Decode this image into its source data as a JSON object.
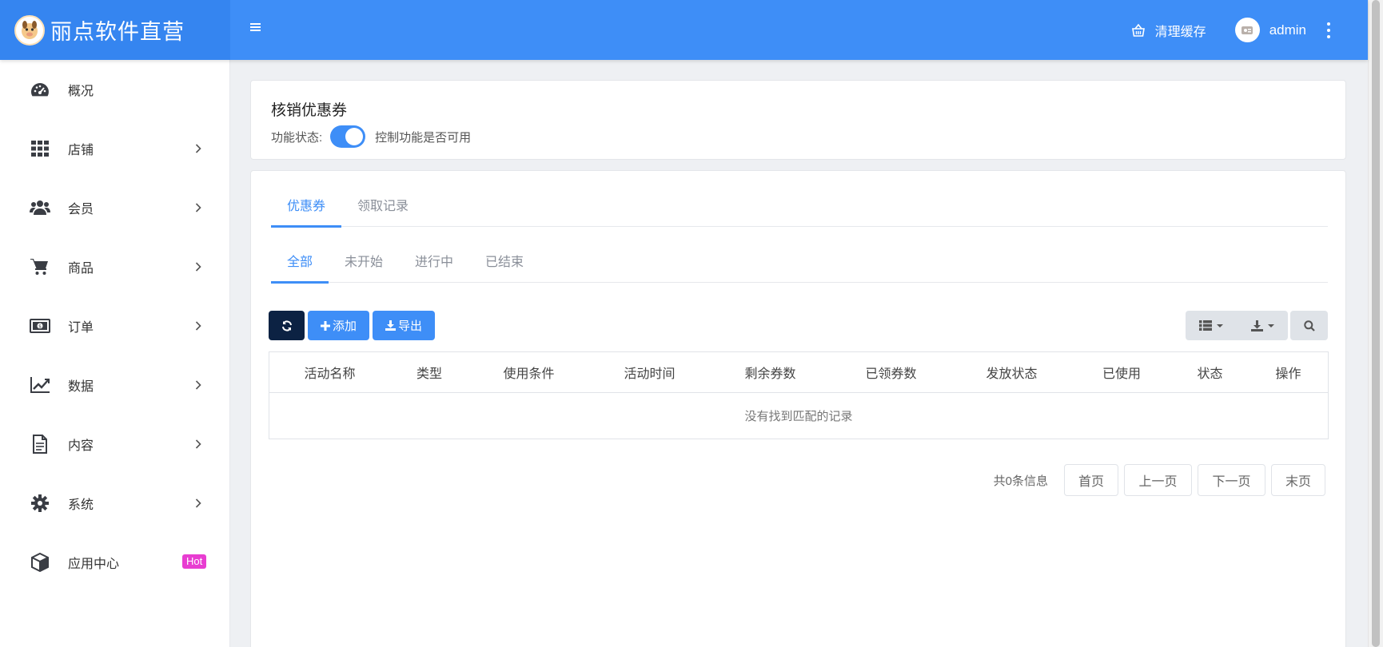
{
  "header": {
    "brand_title": "丽点软件直营",
    "clear_cache_label": "清理缓存",
    "user_name": "admin"
  },
  "sidebar": {
    "items": [
      {
        "label": "概况",
        "icon": "dashboard-icon",
        "has_submenu": false
      },
      {
        "label": "店铺",
        "icon": "grid-icon",
        "has_submenu": true
      },
      {
        "label": "会员",
        "icon": "users-icon",
        "has_submenu": true
      },
      {
        "label": "商品",
        "icon": "cart-icon",
        "has_submenu": true
      },
      {
        "label": "订单",
        "icon": "money-icon",
        "has_submenu": true
      },
      {
        "label": "数据",
        "icon": "line-chart-icon",
        "has_submenu": true
      },
      {
        "label": "内容",
        "icon": "document-icon",
        "has_submenu": true
      },
      {
        "label": "系统",
        "icon": "gear-icon",
        "has_submenu": true
      },
      {
        "label": "应用中心",
        "icon": "cube-icon",
        "has_submenu": false,
        "badge": "Hot"
      }
    ]
  },
  "status_card": {
    "title": "核销优惠券",
    "status_label": "功能状态:",
    "toggle_on": true,
    "status_hint": "控制功能是否可用"
  },
  "main_tabs": [
    {
      "label": "优惠券",
      "active": true
    },
    {
      "label": "领取记录",
      "active": false
    }
  ],
  "filter_tabs": [
    {
      "label": "全部",
      "active": true
    },
    {
      "label": "未开始",
      "active": false
    },
    {
      "label": "进行中",
      "active": false
    },
    {
      "label": "已结束",
      "active": false
    }
  ],
  "toolbar": {
    "add_label": "添加",
    "export_label": "导出"
  },
  "table": {
    "columns": [
      "活动名称",
      "类型",
      "使用条件",
      "活动时间",
      "剩余券数",
      "已领券数",
      "发放状态",
      "已使用",
      "状态",
      "操作"
    ],
    "empty_text": "没有找到匹配的记录"
  },
  "pagination": {
    "info": "共0条信息",
    "first": "首页",
    "prev": "上一页",
    "next": "下一页",
    "last": "末页"
  },
  "colors": {
    "primary": "#3e8ef7",
    "dark_button": "#0c2243",
    "hot_badge": "#e83dd1"
  }
}
